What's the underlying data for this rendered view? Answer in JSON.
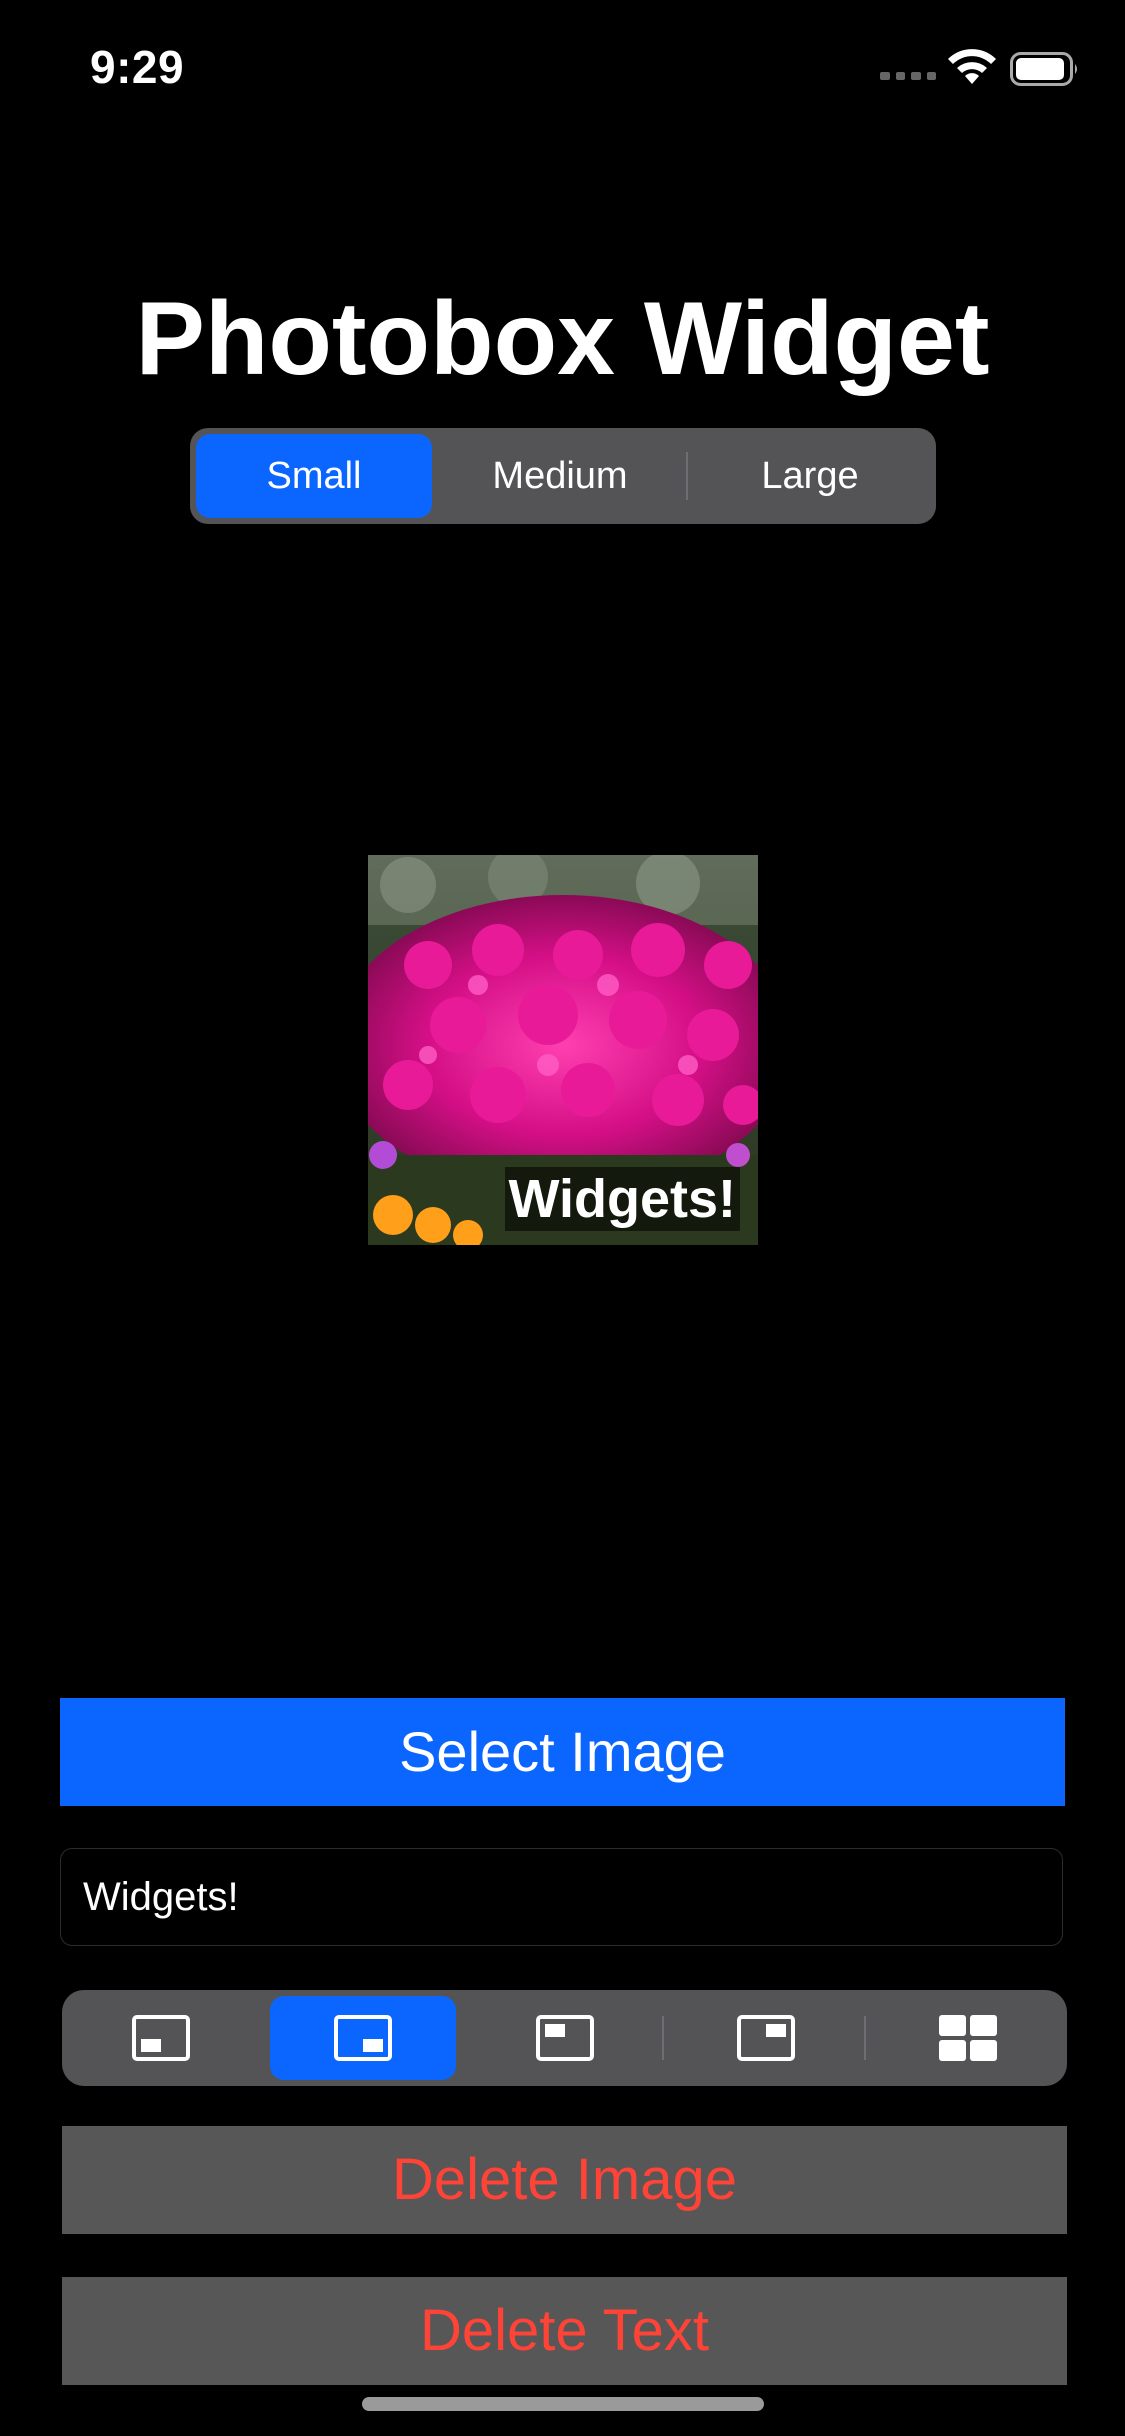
{
  "status_bar": {
    "time": "9:29"
  },
  "app": {
    "title": "Photobox Widget"
  },
  "size_selector": {
    "options": [
      "Small",
      "Medium",
      "Large"
    ],
    "selected": "Small"
  },
  "preview": {
    "caption": "Widgets!"
  },
  "buttons": {
    "select_image": "Select Image",
    "delete_image": "Delete Image",
    "delete_text": "Delete Text"
  },
  "text_field": {
    "value": "Widgets!"
  },
  "layout_selector": {
    "options": [
      "bottom-left-text-icon",
      "bottom-right-text-icon",
      "top-left-text-icon",
      "top-right-text-icon",
      "grid-icon"
    ],
    "selected": "bottom-right-text-icon"
  },
  "colors": {
    "accent": "#0a66ff",
    "destructive": "#ff4337",
    "control_bg": "#545456",
    "background": "#000000"
  }
}
